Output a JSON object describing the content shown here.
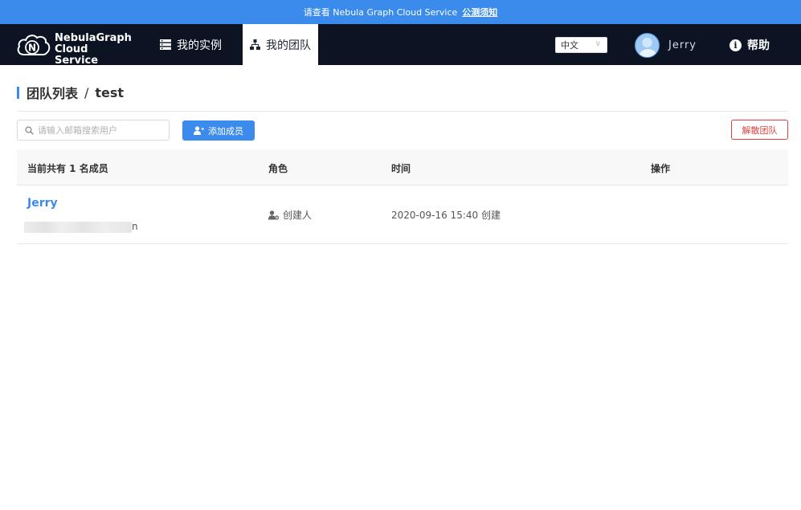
{
  "announcement": {
    "text": "请查看 Nebula Graph Cloud Service",
    "link": "公测须知"
  },
  "navbar": {
    "logo_line1": "NebulaGraph",
    "logo_line2": "Cloud Service",
    "items": [
      {
        "label": "我的实例",
        "icon": "server-icon",
        "active": false
      },
      {
        "label": "我的团队",
        "icon": "team-icon",
        "active": true
      }
    ],
    "language": "中文",
    "user_name": "Jerry",
    "help_label": "帮助"
  },
  "page": {
    "breadcrumb_root": "团队列表",
    "breadcrumb_sep": "/",
    "team_name": "test"
  },
  "toolbar": {
    "search_placeholder": "请输入邮箱搜索用户",
    "add_member_label": "添加成员",
    "disband_label": "解散团队"
  },
  "table": {
    "columns": [
      "当前共有 1 名成员",
      "角色",
      "时间",
      "操作"
    ],
    "rows": [
      {
        "name": "Jerry",
        "email_visible_tail": "n",
        "role": "创建人",
        "time": "2020-09-16 15:40 创建"
      }
    ]
  },
  "colors": {
    "accent": "#3b8bed",
    "navbar": "#0c1424",
    "danger": "#e0413b"
  }
}
